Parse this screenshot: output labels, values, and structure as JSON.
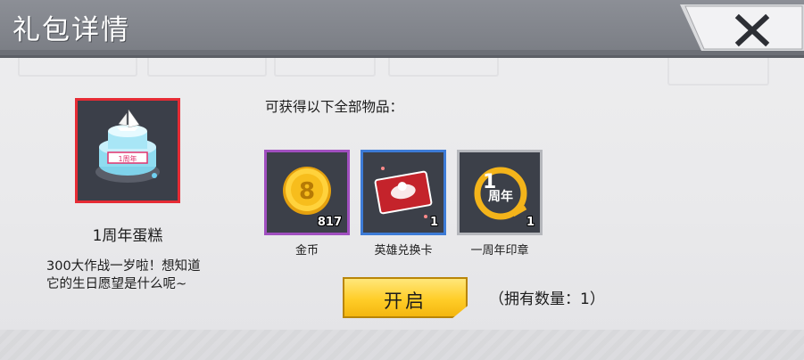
{
  "dialog": {
    "title": "礼包详情",
    "close_icon": "close-x-icon"
  },
  "gift": {
    "icon": "anniversary-cake-icon",
    "name": "1周年蛋糕",
    "badge": "1周年",
    "desc_line1": "300大作战一岁啦！想知道",
    "desc_line2": "它的生日愿望是什么呢~",
    "frame_color": "#e62b34"
  },
  "contents": {
    "label": "可获得以下全部物品：",
    "items": [
      {
        "name": "金币",
        "count": "817",
        "icon": "gold-coin-icon",
        "frame_color": "#a04fbf"
      },
      {
        "name": "英雄兑换卡",
        "count": "1",
        "icon": "hero-exchange-card-icon",
        "frame_color": "#3d7bd6"
      },
      {
        "name": "一周年印章",
        "count": "1",
        "icon": "anniversary-badge-icon",
        "frame_color": "#b5b7bc"
      }
    ]
  },
  "actions": {
    "open_label": "开启",
    "owned_text": "（拥有数量：1）",
    "accent": "#ffcd28"
  }
}
